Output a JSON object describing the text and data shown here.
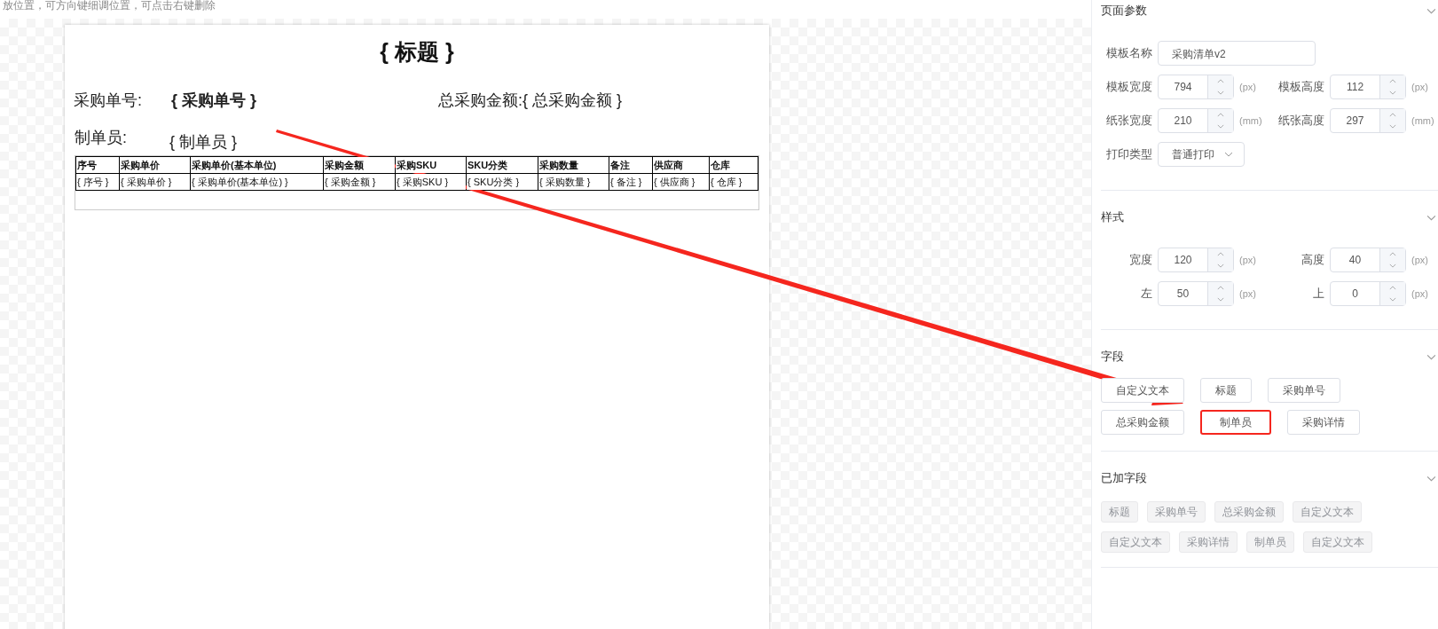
{
  "hint": "放位置，可方向键细调位置，可点击右键删除",
  "paper": {
    "title": "{ 标题 }",
    "fields": [
      {
        "label": "采购单号:",
        "value": "{ 采购单号 }",
        "bold": true
      },
      {
        "label": "总采购金额:",
        "value": "{ 总采购金额 }",
        "bold": false
      },
      {
        "label": "制单员:",
        "value": "{ 制单员 }",
        "bold": false
      }
    ],
    "table": {
      "columns": [
        "序号",
        "采购单价",
        "采购单价(基本单位)",
        "采购金额",
        "采购SKU",
        "SKU分类",
        "采购数量",
        "备注",
        "供应商",
        "仓库"
      ],
      "rows": [
        [
          "{ 序号 }",
          "{ 采购单价 }",
          "{ 采购单价(基本单位) }",
          "{ 采购金额 }",
          "{ 采购SKU }",
          "{ SKU分类 }",
          "{ 采购数量 }",
          "{ 备注 }",
          "{ 供应商 }",
          "{ 仓库 }"
        ]
      ]
    }
  },
  "panel": [
    {
      "kind": "form",
      "title": "页面参数",
      "expanded": true,
      "rows": [
        [
          {
            "label": "模板名称",
            "kind": "text",
            "value": "采购清单v2"
          }
        ],
        [
          {
            "label": "模板宽度",
            "kind": "number",
            "value": "794",
            "unit": "(px)"
          },
          {
            "label": "模板高度",
            "kind": "number",
            "value": "112",
            "unit": "(px)"
          }
        ],
        [
          {
            "label": "纸张宽度",
            "kind": "number",
            "value": "210",
            "unit": "(mm)"
          },
          {
            "label": "纸张高度",
            "kind": "number",
            "value": "297",
            "unit": "(mm)"
          }
        ],
        [
          {
            "label": "打印类型",
            "kind": "select",
            "value": "普通打印"
          }
        ]
      ]
    },
    {
      "kind": "form",
      "title": "样式",
      "expanded": true,
      "rows": [
        [
          {
            "label": "宽度",
            "kind": "number",
            "value": "120",
            "unit": "(px)"
          },
          {
            "label": "高度",
            "kind": "number",
            "value": "40",
            "unit": "(px)"
          }
        ],
        [
          {
            "label": "左",
            "kind": "number",
            "value": "50",
            "unit": "(px)"
          },
          {
            "label": "上",
            "kind": "number",
            "value": "0",
            "unit": "(px)"
          }
        ]
      ]
    },
    {
      "kind": "buttons",
      "title": "字段",
      "expanded": true,
      "items": [
        {
          "label": "自定义文本",
          "highlighted": false
        },
        {
          "label": "标题",
          "highlighted": false
        },
        {
          "label": "采购单号",
          "highlighted": false
        },
        {
          "label": "总采购金额",
          "highlighted": false
        },
        {
          "label": "制单员",
          "highlighted": true
        },
        {
          "label": "采购详情",
          "highlighted": false
        }
      ]
    },
    {
      "kind": "tags",
      "title": "已加字段",
      "expanded": true,
      "items": [
        "标题",
        "采购单号",
        "总采购金额",
        "自定义文本",
        "自定义文本",
        "采购详情",
        "制单员",
        "自定义文本"
      ]
    }
  ]
}
